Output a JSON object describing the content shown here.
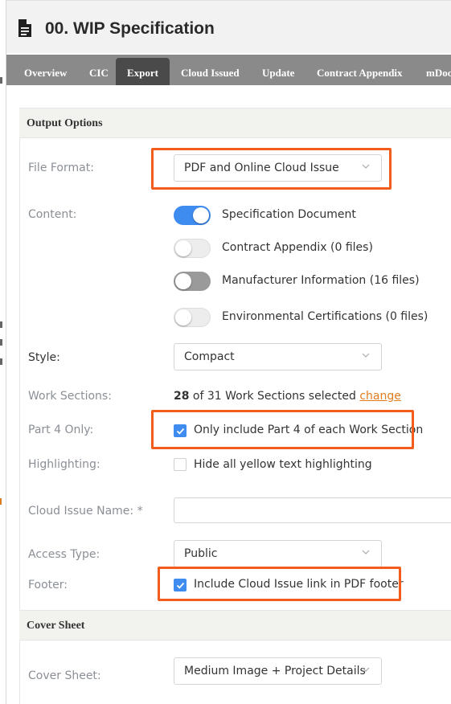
{
  "window": {
    "title": "00. WIP Specification"
  },
  "icons": {
    "document": "document-icon",
    "dropdown": "chevron-down-icon",
    "check": "checkmark-icon"
  },
  "colors": {
    "accent": "#3f8cf0",
    "highlight_box": "#f25d1c",
    "link": "#e07b1f",
    "tab_bar": "#8a8a8a",
    "tab_active": "#4a4a4a"
  },
  "tabs": [
    {
      "label": "Overview",
      "active": false
    },
    {
      "label": "CIC",
      "active": false
    },
    {
      "label": "Export",
      "active": true
    },
    {
      "label": "Cloud Issued",
      "active": false
    },
    {
      "label": "Update",
      "active": false
    },
    {
      "label": "Contract Appendix",
      "active": false
    },
    {
      "label": "mDoc",
      "active": false
    }
  ],
  "output_options": {
    "heading": "Output Options",
    "file_format": {
      "label": "File Format:",
      "value": "PDF and Online Cloud Issue"
    },
    "content": {
      "label": "Content:",
      "items": [
        {
          "label": "Specification Document",
          "enabled": true
        },
        {
          "label": "Contract Appendix (0 files)",
          "enabled": false
        },
        {
          "label": "Manufacturer Information (16 files)",
          "enabled": false
        },
        {
          "label": "Environmental Certifications (0 files)",
          "enabled": false
        }
      ]
    },
    "style": {
      "label": "Style:",
      "value": "Compact"
    },
    "work_sections": {
      "label": "Work Sections:",
      "selected": "28",
      "rest": " of 31 Work Sections selected ",
      "link": "change"
    },
    "part4_only": {
      "label": "Part 4 Only:",
      "text": "Only include Part 4 of each Work Section",
      "checked": true
    },
    "highlighting": {
      "label": "Highlighting:",
      "text": "Hide all yellow text highlighting",
      "checked": false
    },
    "cloud_issue_name": {
      "label": "Cloud Issue Name: *",
      "value": ""
    },
    "access_type": {
      "label": "Access Type:",
      "value": "Public"
    },
    "footer": {
      "label": "Footer:",
      "text": "Include Cloud Issue link in PDF footer",
      "checked": true
    }
  },
  "cover_sheet": {
    "heading": "Cover Sheet",
    "cover_sheet": {
      "label": "Cover Sheet:",
      "value": "Medium Image + Project Details"
    }
  }
}
